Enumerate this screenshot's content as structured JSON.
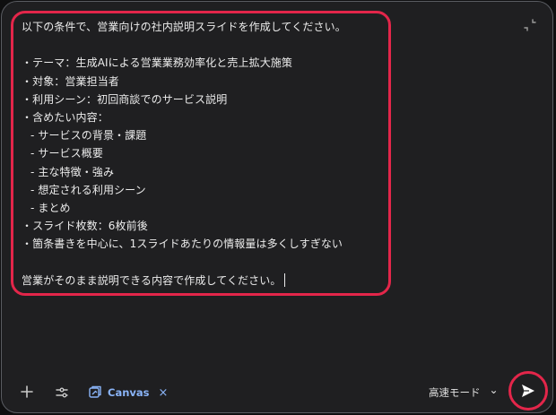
{
  "prompt": {
    "lines": [
      "以下の条件で、営業向けの社内説明スライドを作成してください。",
      "",
      "・テーマ：生成AIによる営業業務効率化と売上拡大施策",
      "・対象：営業担当者",
      "・利用シーン：初回商談でのサービス説明",
      "・含めたい内容：",
      "- サービスの背景・課題",
      "- サービス概要",
      "- 主な特徴・強み",
      "- 想定される利用シーン",
      "- まとめ",
      "・スライド枚数：6枚前後",
      "・箇条書きを中心に、1スライドあたりの情報量は多くしすぎない",
      "",
      "営業がそのまま説明できる内容で作成してください。"
    ]
  },
  "toolbar": {
    "canvas_label": "Canvas",
    "canvas_close": "×",
    "mode_label": "高速モード",
    "mode_chevron": "⌄"
  },
  "icons": {
    "add": "plus-icon",
    "tools": "sliders-icon",
    "canvas": "canvas-icon",
    "send": "send-icon",
    "collapse": "collapse-icon"
  },
  "colors": {
    "highlight": "#e3264a",
    "accent": "#8ab4f8",
    "panel": "#1f1f21"
  }
}
